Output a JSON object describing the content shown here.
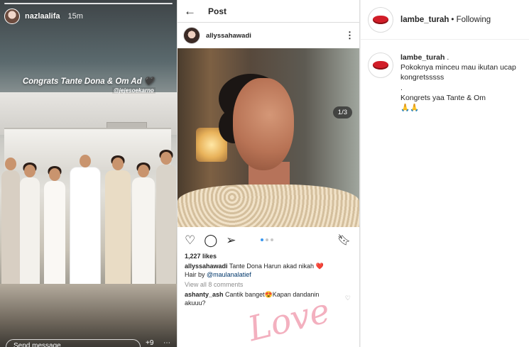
{
  "story": {
    "username": "nazlaalifa",
    "time": "15m",
    "congrats_text": "Congrats Tante Dona & Om Ad",
    "tag": "@jejesoekarno",
    "reply_placeholder": "Send message",
    "reply_count": "+9"
  },
  "post": {
    "header_title": "Post",
    "username": "allyssahawadi",
    "image_counter": "1/3",
    "likes": "1,227 likes",
    "caption_user": "allyssahawadi",
    "caption_text": "Tante Dona Harun akad nikah ❤️",
    "caption_line2_prefix": "Hair by",
    "caption_mention": "@maulanalatief",
    "view_comments": "View all 8 comments",
    "comment_user": "ashanty_ash",
    "comment_text": "Cantik banget😍Kapan dandanin akuuu?",
    "overlay_text": "Love"
  },
  "side": {
    "username": "lambe_turah",
    "following": "• Following",
    "comment_user": "lambe_turah",
    "comment_text": ".\nPokoknya minceu mau ikutan ucap\nkongretsssss\n.\nKongrets yaa Tante & Om\n🙏🙏"
  },
  "colors": {
    "accent_blue": "#3897f0",
    "text": "#262626",
    "muted": "#8e8e8e",
    "brand_red": "#d11d28"
  }
}
